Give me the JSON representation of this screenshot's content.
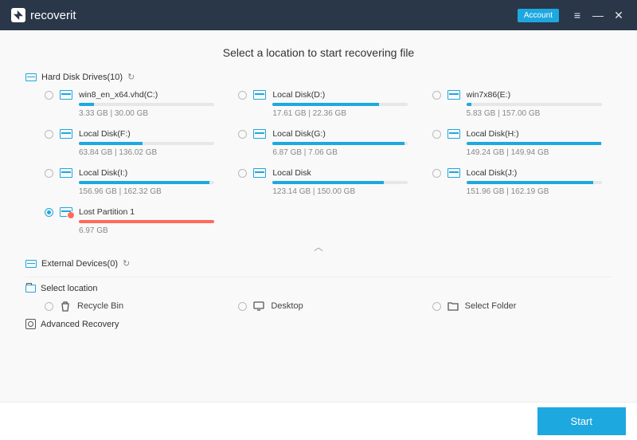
{
  "titlebar": {
    "app_name": "recoverit",
    "account_label": "Account"
  },
  "page_title": "Select a location to start recovering file",
  "sections": {
    "hard_disk": {
      "label": "Hard Disk Drives(10)",
      "drives": [
        {
          "name": "win8_en_x64.vhd(C:)",
          "used": 3.33,
          "total": 30.0,
          "size_text": "3.33  GB | 30.00  GB"
        },
        {
          "name": "Local Disk(D:)",
          "used": 17.61,
          "total": 22.36,
          "size_text": "17.61  GB | 22.36  GB"
        },
        {
          "name": "win7x86(E:)",
          "used": 5.83,
          "total": 157.0,
          "size_text": "5.83  GB | 157.00  GB"
        },
        {
          "name": "Local Disk(F:)",
          "used": 63.84,
          "total": 136.02,
          "size_text": "63.84  GB | 136.02  GB"
        },
        {
          "name": "Local Disk(G:)",
          "used": 6.87,
          "total": 7.06,
          "size_text": "6.87  GB | 7.06  GB"
        },
        {
          "name": "Local Disk(H:)",
          "used": 149.24,
          "total": 149.94,
          "size_text": "149.24  GB | 149.94  GB"
        },
        {
          "name": "Local Disk(I:)",
          "used": 156.96,
          "total": 162.32,
          "size_text": "156.96  GB | 162.32  GB"
        },
        {
          "name": "Local Disk",
          "used": 123.14,
          "total": 150.0,
          "size_text": "123.14  GB | 150.00  GB"
        },
        {
          "name": "Local Disk(J:)",
          "used": 151.96,
          "total": 162.19,
          "size_text": "151.96  GB | 162.19  GB"
        },
        {
          "name": "Lost Partition 1",
          "used": 6.97,
          "total": 6.97,
          "size_text": "6.97  GB",
          "lost": true,
          "selected": true
        }
      ]
    },
    "external": {
      "label": "External Devices(0)"
    },
    "select_location": {
      "label": "Select location",
      "items": [
        {
          "name": "Recycle Bin",
          "icon": "recycle-bin-icon"
        },
        {
          "name": "Desktop",
          "icon": "desktop-icon"
        },
        {
          "name": "Select Folder",
          "icon": "folder-icon"
        }
      ]
    },
    "advanced": {
      "label": "Advanced Recovery"
    }
  },
  "footer": {
    "start_label": "Start"
  },
  "colors": {
    "accent": "#1ea8e0",
    "danger": "#ff6b5b",
    "header": "#293749"
  }
}
